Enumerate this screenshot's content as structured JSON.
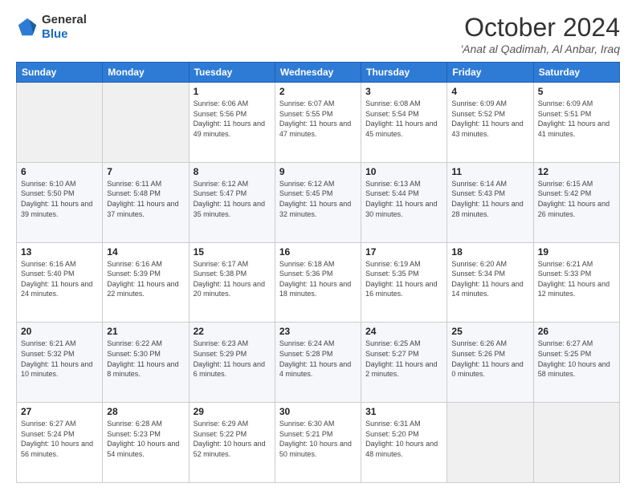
{
  "header": {
    "logo": {
      "line1": "General",
      "line2": "Blue"
    },
    "title": "October 2024",
    "subtitle": "'Anat al Qadimah, Al Anbar, Iraq"
  },
  "weekdays": [
    "Sunday",
    "Monday",
    "Tuesday",
    "Wednesday",
    "Thursday",
    "Friday",
    "Saturday"
  ],
  "weeks": [
    [
      {
        "day": "",
        "info": ""
      },
      {
        "day": "",
        "info": ""
      },
      {
        "day": "1",
        "info": "Sunrise: 6:06 AM\nSunset: 5:56 PM\nDaylight: 11 hours and 49 minutes."
      },
      {
        "day": "2",
        "info": "Sunrise: 6:07 AM\nSunset: 5:55 PM\nDaylight: 11 hours and 47 minutes."
      },
      {
        "day": "3",
        "info": "Sunrise: 6:08 AM\nSunset: 5:54 PM\nDaylight: 11 hours and 45 minutes."
      },
      {
        "day": "4",
        "info": "Sunrise: 6:09 AM\nSunset: 5:52 PM\nDaylight: 11 hours and 43 minutes."
      },
      {
        "day": "5",
        "info": "Sunrise: 6:09 AM\nSunset: 5:51 PM\nDaylight: 11 hours and 41 minutes."
      }
    ],
    [
      {
        "day": "6",
        "info": "Sunrise: 6:10 AM\nSunset: 5:50 PM\nDaylight: 11 hours and 39 minutes."
      },
      {
        "day": "7",
        "info": "Sunrise: 6:11 AM\nSunset: 5:48 PM\nDaylight: 11 hours and 37 minutes."
      },
      {
        "day": "8",
        "info": "Sunrise: 6:12 AM\nSunset: 5:47 PM\nDaylight: 11 hours and 35 minutes."
      },
      {
        "day": "9",
        "info": "Sunrise: 6:12 AM\nSunset: 5:45 PM\nDaylight: 11 hours and 32 minutes."
      },
      {
        "day": "10",
        "info": "Sunrise: 6:13 AM\nSunset: 5:44 PM\nDaylight: 11 hours and 30 minutes."
      },
      {
        "day": "11",
        "info": "Sunrise: 6:14 AM\nSunset: 5:43 PM\nDaylight: 11 hours and 28 minutes."
      },
      {
        "day": "12",
        "info": "Sunrise: 6:15 AM\nSunset: 5:42 PM\nDaylight: 11 hours and 26 minutes."
      }
    ],
    [
      {
        "day": "13",
        "info": "Sunrise: 6:16 AM\nSunset: 5:40 PM\nDaylight: 11 hours and 24 minutes."
      },
      {
        "day": "14",
        "info": "Sunrise: 6:16 AM\nSunset: 5:39 PM\nDaylight: 11 hours and 22 minutes."
      },
      {
        "day": "15",
        "info": "Sunrise: 6:17 AM\nSunset: 5:38 PM\nDaylight: 11 hours and 20 minutes."
      },
      {
        "day": "16",
        "info": "Sunrise: 6:18 AM\nSunset: 5:36 PM\nDaylight: 11 hours and 18 minutes."
      },
      {
        "day": "17",
        "info": "Sunrise: 6:19 AM\nSunset: 5:35 PM\nDaylight: 11 hours and 16 minutes."
      },
      {
        "day": "18",
        "info": "Sunrise: 6:20 AM\nSunset: 5:34 PM\nDaylight: 11 hours and 14 minutes."
      },
      {
        "day": "19",
        "info": "Sunrise: 6:21 AM\nSunset: 5:33 PM\nDaylight: 11 hours and 12 minutes."
      }
    ],
    [
      {
        "day": "20",
        "info": "Sunrise: 6:21 AM\nSunset: 5:32 PM\nDaylight: 11 hours and 10 minutes."
      },
      {
        "day": "21",
        "info": "Sunrise: 6:22 AM\nSunset: 5:30 PM\nDaylight: 11 hours and 8 minutes."
      },
      {
        "day": "22",
        "info": "Sunrise: 6:23 AM\nSunset: 5:29 PM\nDaylight: 11 hours and 6 minutes."
      },
      {
        "day": "23",
        "info": "Sunrise: 6:24 AM\nSunset: 5:28 PM\nDaylight: 11 hours and 4 minutes."
      },
      {
        "day": "24",
        "info": "Sunrise: 6:25 AM\nSunset: 5:27 PM\nDaylight: 11 hours and 2 minutes."
      },
      {
        "day": "25",
        "info": "Sunrise: 6:26 AM\nSunset: 5:26 PM\nDaylight: 11 hours and 0 minutes."
      },
      {
        "day": "26",
        "info": "Sunrise: 6:27 AM\nSunset: 5:25 PM\nDaylight: 10 hours and 58 minutes."
      }
    ],
    [
      {
        "day": "27",
        "info": "Sunrise: 6:27 AM\nSunset: 5:24 PM\nDaylight: 10 hours and 56 minutes."
      },
      {
        "day": "28",
        "info": "Sunrise: 6:28 AM\nSunset: 5:23 PM\nDaylight: 10 hours and 54 minutes."
      },
      {
        "day": "29",
        "info": "Sunrise: 6:29 AM\nSunset: 5:22 PM\nDaylight: 10 hours and 52 minutes."
      },
      {
        "day": "30",
        "info": "Sunrise: 6:30 AM\nSunset: 5:21 PM\nDaylight: 10 hours and 50 minutes."
      },
      {
        "day": "31",
        "info": "Sunrise: 6:31 AM\nSunset: 5:20 PM\nDaylight: 10 hours and 48 minutes."
      },
      {
        "day": "",
        "info": ""
      },
      {
        "day": "",
        "info": ""
      }
    ]
  ]
}
